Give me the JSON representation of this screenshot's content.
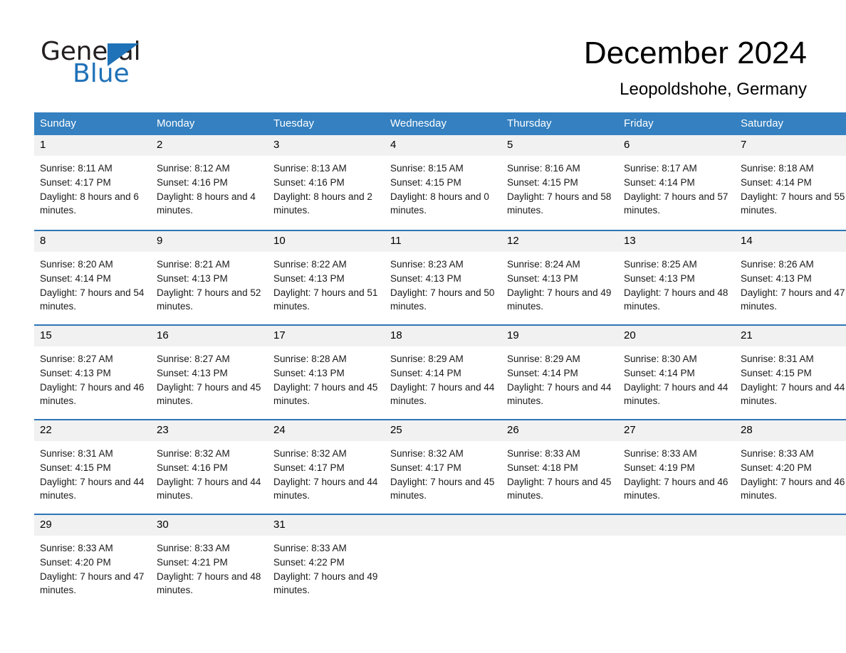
{
  "brand": {
    "name_part1": "General",
    "name_part2": "Blue",
    "accent_color": "#1f72b8",
    "triangle_icon": "brand-triangle-icon"
  },
  "header": {
    "month_title": "December 2024",
    "location": "Leopoldshohe, Germany"
  },
  "calendar": {
    "header_background": "#3480c0",
    "row_divider_color": "#2e75b6",
    "daynum_background": "#f1f1f1",
    "weekday_headers": [
      "Sunday",
      "Monday",
      "Tuesday",
      "Wednesday",
      "Thursday",
      "Friday",
      "Saturday"
    ],
    "weeks": [
      [
        {
          "day": "1",
          "sunrise": "Sunrise: 8:11 AM",
          "sunset": "Sunset: 4:17 PM",
          "daylight": "Daylight: 8 hours and 6 minutes."
        },
        {
          "day": "2",
          "sunrise": "Sunrise: 8:12 AM",
          "sunset": "Sunset: 4:16 PM",
          "daylight": "Daylight: 8 hours and 4 minutes."
        },
        {
          "day": "3",
          "sunrise": "Sunrise: 8:13 AM",
          "sunset": "Sunset: 4:16 PM",
          "daylight": "Daylight: 8 hours and 2 minutes."
        },
        {
          "day": "4",
          "sunrise": "Sunrise: 8:15 AM",
          "sunset": "Sunset: 4:15 PM",
          "daylight": "Daylight: 8 hours and 0 minutes."
        },
        {
          "day": "5",
          "sunrise": "Sunrise: 8:16 AM",
          "sunset": "Sunset: 4:15 PM",
          "daylight": "Daylight: 7 hours and 58 minutes."
        },
        {
          "day": "6",
          "sunrise": "Sunrise: 8:17 AM",
          "sunset": "Sunset: 4:14 PM",
          "daylight": "Daylight: 7 hours and 57 minutes."
        },
        {
          "day": "7",
          "sunrise": "Sunrise: 8:18 AM",
          "sunset": "Sunset: 4:14 PM",
          "daylight": "Daylight: 7 hours and 55 minutes."
        }
      ],
      [
        {
          "day": "8",
          "sunrise": "Sunrise: 8:20 AM",
          "sunset": "Sunset: 4:14 PM",
          "daylight": "Daylight: 7 hours and 54 minutes."
        },
        {
          "day": "9",
          "sunrise": "Sunrise: 8:21 AM",
          "sunset": "Sunset: 4:13 PM",
          "daylight": "Daylight: 7 hours and 52 minutes."
        },
        {
          "day": "10",
          "sunrise": "Sunrise: 8:22 AM",
          "sunset": "Sunset: 4:13 PM",
          "daylight": "Daylight: 7 hours and 51 minutes."
        },
        {
          "day": "11",
          "sunrise": "Sunrise: 8:23 AM",
          "sunset": "Sunset: 4:13 PM",
          "daylight": "Daylight: 7 hours and 50 minutes."
        },
        {
          "day": "12",
          "sunrise": "Sunrise: 8:24 AM",
          "sunset": "Sunset: 4:13 PM",
          "daylight": "Daylight: 7 hours and 49 minutes."
        },
        {
          "day": "13",
          "sunrise": "Sunrise: 8:25 AM",
          "sunset": "Sunset: 4:13 PM",
          "daylight": "Daylight: 7 hours and 48 minutes."
        },
        {
          "day": "14",
          "sunrise": "Sunrise: 8:26 AM",
          "sunset": "Sunset: 4:13 PM",
          "daylight": "Daylight: 7 hours and 47 minutes."
        }
      ],
      [
        {
          "day": "15",
          "sunrise": "Sunrise: 8:27 AM",
          "sunset": "Sunset: 4:13 PM",
          "daylight": "Daylight: 7 hours and 46 minutes."
        },
        {
          "day": "16",
          "sunrise": "Sunrise: 8:27 AM",
          "sunset": "Sunset: 4:13 PM",
          "daylight": "Daylight: 7 hours and 45 minutes."
        },
        {
          "day": "17",
          "sunrise": "Sunrise: 8:28 AM",
          "sunset": "Sunset: 4:13 PM",
          "daylight": "Daylight: 7 hours and 45 minutes."
        },
        {
          "day": "18",
          "sunrise": "Sunrise: 8:29 AM",
          "sunset": "Sunset: 4:14 PM",
          "daylight": "Daylight: 7 hours and 44 minutes."
        },
        {
          "day": "19",
          "sunrise": "Sunrise: 8:29 AM",
          "sunset": "Sunset: 4:14 PM",
          "daylight": "Daylight: 7 hours and 44 minutes."
        },
        {
          "day": "20",
          "sunrise": "Sunrise: 8:30 AM",
          "sunset": "Sunset: 4:14 PM",
          "daylight": "Daylight: 7 hours and 44 minutes."
        },
        {
          "day": "21",
          "sunrise": "Sunrise: 8:31 AM",
          "sunset": "Sunset: 4:15 PM",
          "daylight": "Daylight: 7 hours and 44 minutes."
        }
      ],
      [
        {
          "day": "22",
          "sunrise": "Sunrise: 8:31 AM",
          "sunset": "Sunset: 4:15 PM",
          "daylight": "Daylight: 7 hours and 44 minutes."
        },
        {
          "day": "23",
          "sunrise": "Sunrise: 8:32 AM",
          "sunset": "Sunset: 4:16 PM",
          "daylight": "Daylight: 7 hours and 44 minutes."
        },
        {
          "day": "24",
          "sunrise": "Sunrise: 8:32 AM",
          "sunset": "Sunset: 4:17 PM",
          "daylight": "Daylight: 7 hours and 44 minutes."
        },
        {
          "day": "25",
          "sunrise": "Sunrise: 8:32 AM",
          "sunset": "Sunset: 4:17 PM",
          "daylight": "Daylight: 7 hours and 45 minutes."
        },
        {
          "day": "26",
          "sunrise": "Sunrise: 8:33 AM",
          "sunset": "Sunset: 4:18 PM",
          "daylight": "Daylight: 7 hours and 45 minutes."
        },
        {
          "day": "27",
          "sunrise": "Sunrise: 8:33 AM",
          "sunset": "Sunset: 4:19 PM",
          "daylight": "Daylight: 7 hours and 46 minutes."
        },
        {
          "day": "28",
          "sunrise": "Sunrise: 8:33 AM",
          "sunset": "Sunset: 4:20 PM",
          "daylight": "Daylight: 7 hours and 46 minutes."
        }
      ],
      [
        {
          "day": "29",
          "sunrise": "Sunrise: 8:33 AM",
          "sunset": "Sunset: 4:20 PM",
          "daylight": "Daylight: 7 hours and 47 minutes."
        },
        {
          "day": "30",
          "sunrise": "Sunrise: 8:33 AM",
          "sunset": "Sunset: 4:21 PM",
          "daylight": "Daylight: 7 hours and 48 minutes."
        },
        {
          "day": "31",
          "sunrise": "Sunrise: 8:33 AM",
          "sunset": "Sunset: 4:22 PM",
          "daylight": "Daylight: 7 hours and 49 minutes."
        },
        {
          "day": "",
          "sunrise": "",
          "sunset": "",
          "daylight": ""
        },
        {
          "day": "",
          "sunrise": "",
          "sunset": "",
          "daylight": ""
        },
        {
          "day": "",
          "sunrise": "",
          "sunset": "",
          "daylight": ""
        },
        {
          "day": "",
          "sunrise": "",
          "sunset": "",
          "daylight": ""
        }
      ]
    ]
  }
}
